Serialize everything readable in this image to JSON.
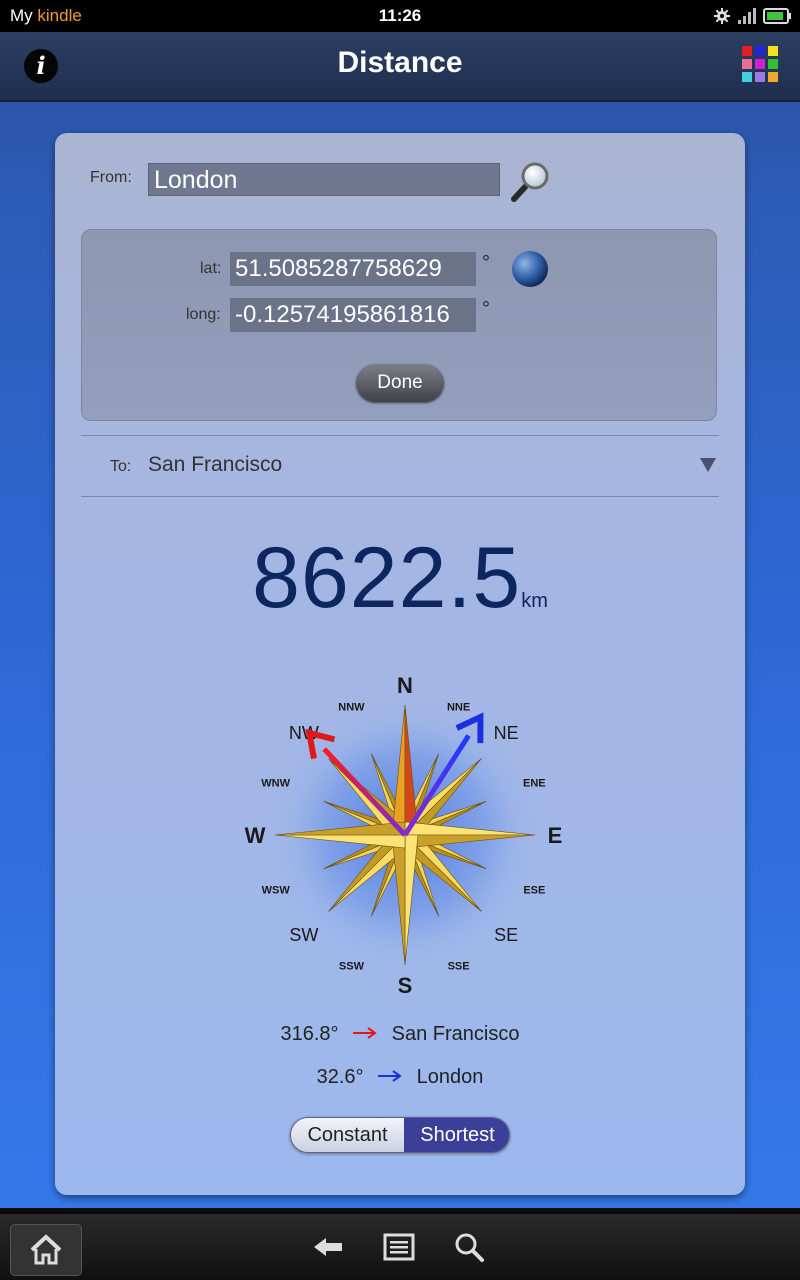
{
  "status_bar": {
    "app_prefix": "My",
    "app_name": "kindle",
    "time": "11:26"
  },
  "header": {
    "title": "Distance",
    "info_label": "i"
  },
  "from": {
    "label": "From:",
    "value": "London"
  },
  "coordinates": {
    "lat_label": "lat:",
    "lat_value": "51.5085287758629",
    "long_label": "long:",
    "long_value": "-0.12574195861816",
    "degree_symbol": "°",
    "done_label": "Done"
  },
  "to": {
    "label": "To:",
    "value": "San Francisco"
  },
  "distance": {
    "value": "8622.5",
    "unit": "km"
  },
  "compass": {
    "labels": [
      "N",
      "NNE",
      "NE",
      "ENE",
      "E",
      "ESE",
      "SE",
      "SSE",
      "S",
      "SSW",
      "SW",
      "WSW",
      "W",
      "WNW",
      "NW",
      "NNW"
    ],
    "red_bearing_deg": 316.8,
    "blue_bearing_deg": 32.6
  },
  "bearings": [
    {
      "value": "316.8°",
      "destination": "San Francisco",
      "arrow_color": "#e01818"
    },
    {
      "value": "32.6°",
      "destination": "London",
      "arrow_color": "#1a2fe0"
    }
  ],
  "mode_toggle": {
    "options": [
      "Constant",
      "Shortest"
    ],
    "selected": "Shortest"
  },
  "colors": {
    "accent": "#3c3f97",
    "distance_text": "#0e2660"
  }
}
